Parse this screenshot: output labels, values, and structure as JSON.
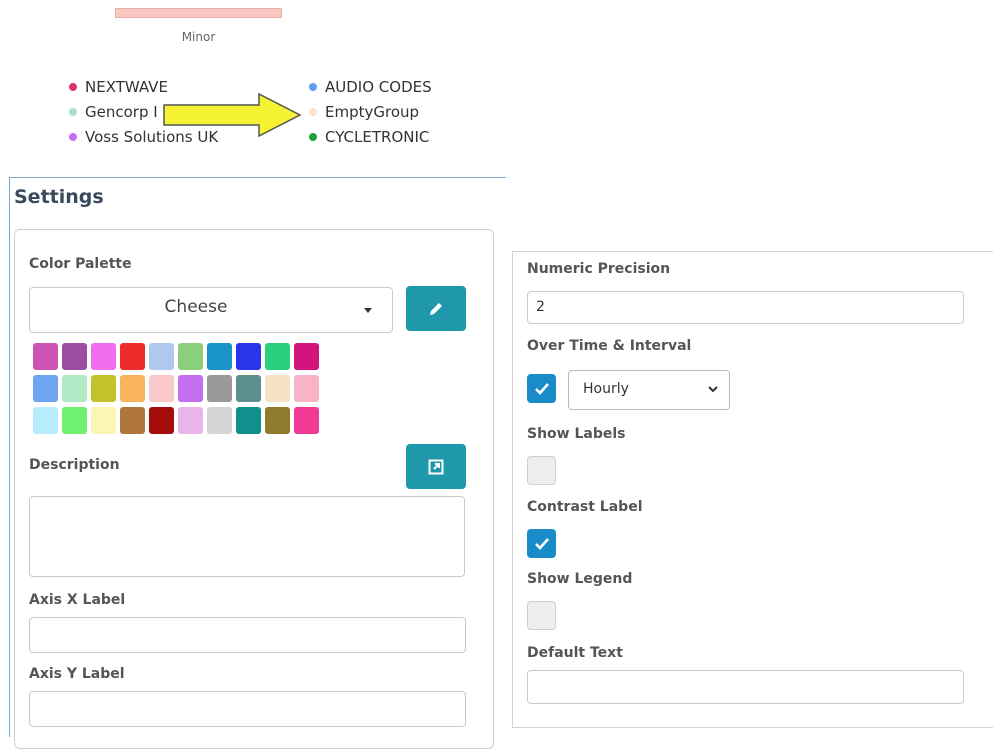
{
  "chart_fragment": {
    "bar_label": "Minor",
    "bar_color": "#f7c9c2"
  },
  "legend": {
    "items": [
      {
        "label": "NEXTWAVE",
        "color": "#e0336e"
      },
      {
        "label": "Gencorp I",
        "color": "#a8e0c4"
      },
      {
        "label": "Voss Solutions UK",
        "color": "#c86ef0"
      },
      {
        "label": "AUDIO CODES",
        "color": "#5b9ff0"
      },
      {
        "label": "EmptyGroup",
        "color": "#fbe3cc"
      },
      {
        "label": "CYCLETRONIC",
        "color": "#1aa33a"
      }
    ]
  },
  "annotation": {
    "arrow_color": "#f5f233"
  },
  "settings": {
    "title": "Settings",
    "color_palette": {
      "label": "Color Palette",
      "selected": "Cheese",
      "edit_icon": "pencil-icon",
      "swatches": [
        "#cc55b3",
        "#9b4da2",
        "#f06ef0",
        "#ee2a2a",
        "#aec8f0",
        "#8ccf7a",
        "#1a94c8",
        "#2b35e8",
        "#2ccf7d",
        "#d1157d",
        "#6ea5f0",
        "#b1eac4",
        "#c4c22a",
        "#f8b45a",
        "#fac8c8",
        "#c46ef0",
        "#9a9a9a",
        "#5e8f8f",
        "#f8e2c6",
        "#f9b3c6",
        "#b8ecfb",
        "#6ff06e",
        "#fbf6b1",
        "#b0773a",
        "#a50c0c",
        "#e9b4e9",
        "#d4d4d4",
        "#0f8f8f",
        "#8f7b2c",
        "#f03a96"
      ]
    },
    "description": {
      "label": "Description",
      "value": "",
      "icon": "expand-icon"
    },
    "axis_x": {
      "label": "Axis X Label",
      "value": ""
    },
    "axis_y": {
      "label": "Axis Y Label",
      "value": ""
    }
  },
  "right_panel": {
    "numeric_precision": {
      "label": "Numeric Precision",
      "value": "2"
    },
    "over_time": {
      "label": "Over Time & Interval",
      "checked": true,
      "interval": "Hourly"
    },
    "show_labels": {
      "label": "Show Labels",
      "checked": false
    },
    "contrast_label": {
      "label": "Contrast Label",
      "checked": true
    },
    "show_legend": {
      "label": "Show Legend",
      "checked": false
    },
    "default_text": {
      "label": "Default Text",
      "value": ""
    }
  }
}
